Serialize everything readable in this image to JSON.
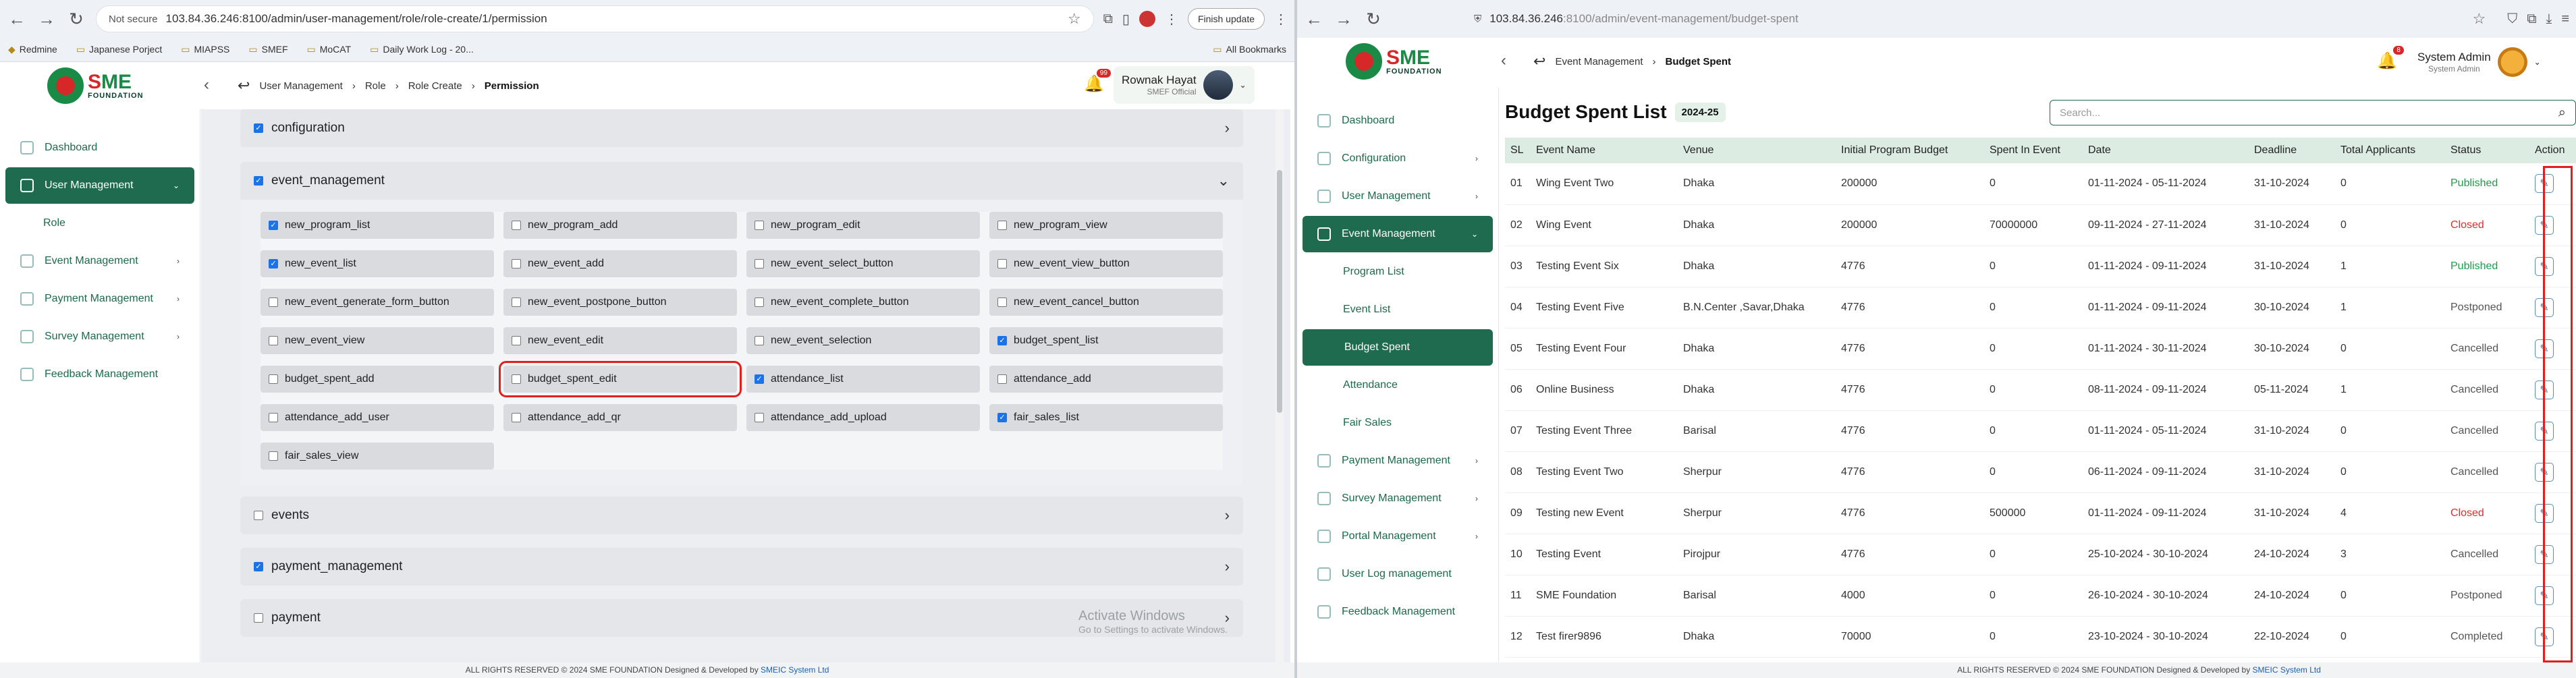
{
  "left_browser": {
    "not_secure": "Not secure",
    "url": "103.84.36.246:8100/admin/user-management/role/role-create/1/permission",
    "finish_update": "Finish update",
    "bookmarks": [
      "Redmine",
      "Japanese Porject",
      "MIAPSS",
      "SMEF",
      "MoCAT",
      "Daily Work Log - 20..."
    ],
    "all_bookmarks": "All Bookmarks"
  },
  "right_browser": {
    "url_host": "103.84.36.246",
    "url_path": ":8100/admin/event-management/budget-spent"
  },
  "brand": {
    "sme_s": "S",
    "sme_me": "ME",
    "foundation": "FOUNDATION"
  },
  "left_app": {
    "breadcrumbs": [
      "User Management",
      "Role",
      "Role Create"
    ],
    "breadcrumb_current": "Permission",
    "notif_count": "99",
    "user_name": "Rownak Hayat",
    "user_role": "SMEF Official",
    "sidebar": [
      {
        "label": "Dashboard"
      },
      {
        "label": "User Management"
      },
      {
        "label": "Role"
      },
      {
        "label": "Event Management"
      },
      {
        "label": "Payment Management"
      },
      {
        "label": "Survey Management"
      },
      {
        "label": "Feedback Management"
      }
    ],
    "sections": [
      {
        "name": "configuration",
        "checked": true
      },
      {
        "name": "event_management",
        "checked": true
      },
      {
        "name": "events",
        "checked": false
      },
      {
        "name": "payment_management",
        "checked": true
      },
      {
        "name": "payment",
        "checked": false
      }
    ],
    "permissions": [
      {
        "name": "new_program_list",
        "checked": true
      },
      {
        "name": "new_program_add",
        "checked": false
      },
      {
        "name": "new_program_edit",
        "checked": false
      },
      {
        "name": "new_program_view",
        "checked": false
      },
      {
        "name": "new_event_list",
        "checked": true
      },
      {
        "name": "new_event_add",
        "checked": false
      },
      {
        "name": "new_event_select_button",
        "checked": false
      },
      {
        "name": "new_event_view_button",
        "checked": false
      },
      {
        "name": "new_event_generate_form_button",
        "checked": false
      },
      {
        "name": "new_event_postpone_button",
        "checked": false
      },
      {
        "name": "new_event_complete_button",
        "checked": false
      },
      {
        "name": "new_event_cancel_button",
        "checked": false
      },
      {
        "name": "new_event_view",
        "checked": false
      },
      {
        "name": "new_event_edit",
        "checked": false
      },
      {
        "name": "new_event_selection",
        "checked": false
      },
      {
        "name": "budget_spent_list",
        "checked": true
      },
      {
        "name": "budget_spent_add",
        "checked": false
      },
      {
        "name": "budget_spent_edit",
        "checked": false
      },
      {
        "name": "attendance_list",
        "checked": true
      },
      {
        "name": "attendance_add",
        "checked": false
      },
      {
        "name": "attendance_add_user",
        "checked": false
      },
      {
        "name": "attendance_add_qr",
        "checked": false
      },
      {
        "name": "attendance_add_upload",
        "checked": false
      },
      {
        "name": "fair_sales_list",
        "checked": true
      },
      {
        "name": "fair_sales_view",
        "checked": false
      }
    ],
    "watermark_title": "Activate Windows",
    "watermark_sub": "Go to Settings to activate Windows.",
    "footer_text": "ALL RIGHTS RESERVED © 2024 SME FOUNDATION   Designed & Developed by",
    "footer_link": "SMEIC System Ltd"
  },
  "right_app": {
    "breadcrumbs": [
      "Event Management"
    ],
    "breadcrumb_current": "Budget Spent",
    "notif_count": "8",
    "user_name": "System Admin",
    "user_role": "System Admin",
    "sidebar": [
      {
        "label": "Dashboard"
      },
      {
        "label": "Configuration"
      },
      {
        "label": "User Management"
      },
      {
        "label": "Event Management"
      },
      {
        "label": "Program List"
      },
      {
        "label": "Event List"
      },
      {
        "label": "Budget Spent"
      },
      {
        "label": "Attendance"
      },
      {
        "label": "Fair Sales"
      },
      {
        "label": "Payment Management"
      },
      {
        "label": "Survey Management"
      },
      {
        "label": "Portal Management"
      },
      {
        "label": "User Log management"
      },
      {
        "label": "Feedback Management"
      }
    ],
    "page_title": "Budget Spent List",
    "fiscal_year": "2024-25",
    "search_placeholder": "Search...",
    "columns": [
      "SL",
      "Event Name",
      "Venue",
      "Initial Program Budget",
      "Spent In Event",
      "Date",
      "Deadline",
      "Total Applicants",
      "Status",
      "Action"
    ],
    "rows": [
      [
        "01",
        "Wing Event Two",
        "Dhaka",
        "200000",
        "0",
        "01-11-2024 - 05-11-2024",
        "31-10-2024",
        "0",
        "Published"
      ],
      [
        "02",
        "Wing Event",
        "Dhaka",
        "200000",
        "70000000",
        "09-11-2024 - 27-11-2024",
        "31-10-2024",
        "0",
        "Closed"
      ],
      [
        "03",
        "Testing Event Six",
        "Dhaka",
        "4776",
        "0",
        "01-11-2024 - 09-11-2024",
        "31-10-2024",
        "1",
        "Published"
      ],
      [
        "04",
        "Testing Event Five",
        "B.N.Center ,Savar,Dhaka",
        "4776",
        "0",
        "01-11-2024 - 09-11-2024",
        "30-10-2024",
        "1",
        "Postponed"
      ],
      [
        "05",
        "Testing Event Four",
        "Dhaka",
        "4776",
        "0",
        "01-11-2024 - 30-11-2024",
        "30-10-2024",
        "0",
        "Cancelled"
      ],
      [
        "06",
        "Online Business",
        "Dhaka",
        "4776",
        "0",
        "08-11-2024 - 09-11-2024",
        "05-11-2024",
        "1",
        "Cancelled"
      ],
      [
        "07",
        "Testing Event Three",
        "Barisal",
        "4776",
        "0",
        "01-11-2024 - 05-11-2024",
        "31-10-2024",
        "0",
        "Cancelled"
      ],
      [
        "08",
        "Testing Event Two",
        "Sherpur",
        "4776",
        "0",
        "06-11-2024 - 09-11-2024",
        "31-10-2024",
        "0",
        "Cancelled"
      ],
      [
        "09",
        "Testing new Event",
        "Sherpur",
        "4776",
        "500000",
        "01-11-2024 - 09-11-2024",
        "31-10-2024",
        "4",
        "Closed"
      ],
      [
        "10",
        "Testing Event",
        "Pirojpur",
        "4776",
        "0",
        "25-10-2024 - 30-10-2024",
        "24-10-2024",
        "3",
        "Cancelled"
      ],
      [
        "11",
        "SME Foundation",
        "Barisal",
        "4000",
        "0",
        "26-10-2024 - 30-10-2024",
        "24-10-2024",
        "0",
        "Postponed"
      ],
      [
        "12",
        "Test firer9896",
        "Dhaka",
        "70000",
        "0",
        "23-10-2024 - 30-10-2024",
        "22-10-2024",
        "0",
        "Completed"
      ]
    ],
    "footer_text": "ALL RIGHTS RESERVED © 2024 SME FOUNDATION   Designed & Developed by",
    "footer_link": "SMEIC System Ltd"
  }
}
